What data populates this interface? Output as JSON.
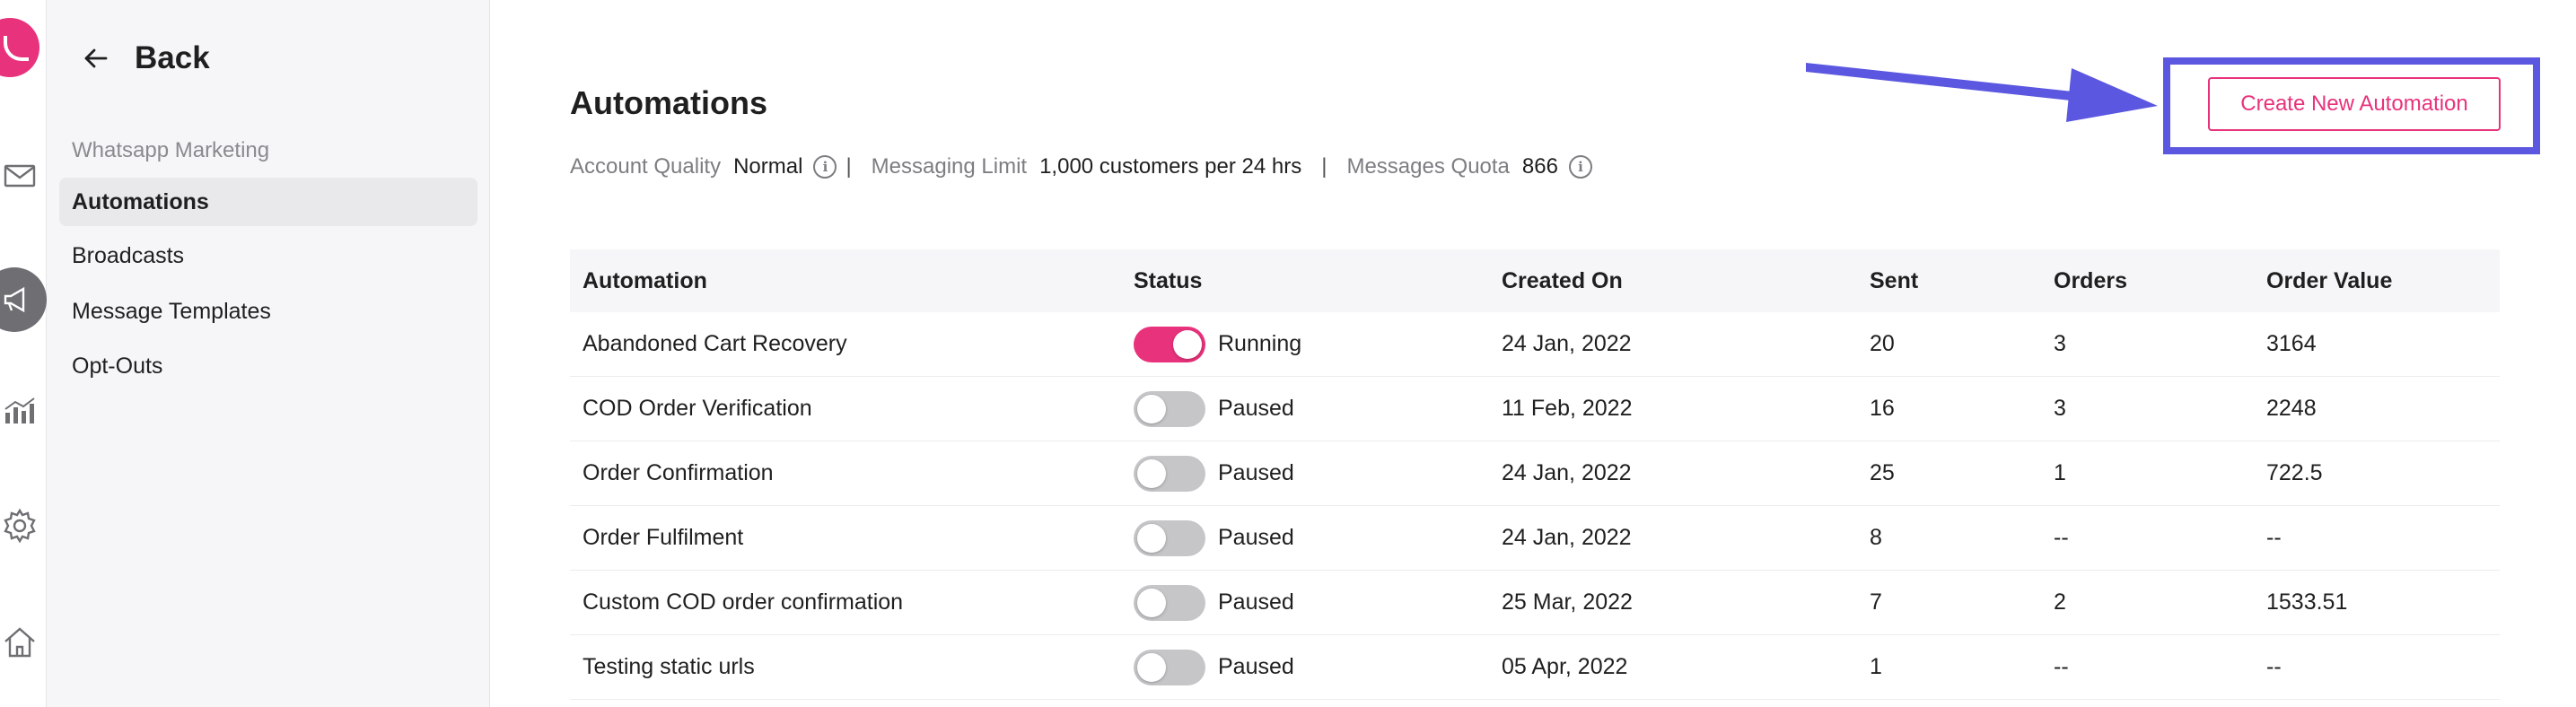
{
  "sidebar": {
    "back_label": "Back",
    "section_label": "Whatsapp Marketing",
    "items": [
      {
        "label": "Automations",
        "active": true
      },
      {
        "label": "Broadcasts",
        "active": false
      },
      {
        "label": "Message Templates",
        "active": false
      },
      {
        "label": "Opt-Outs",
        "active": false
      }
    ]
  },
  "rail": {
    "icons": [
      "logo",
      "mail-icon",
      "megaphone-icon",
      "analytics-icon",
      "gear-icon",
      "home-icon"
    ]
  },
  "main": {
    "title": "Automations",
    "meta": {
      "account_quality_label": "Account Quality",
      "account_quality_value": "Normal",
      "separator": "|",
      "messaging_limit_label": "Messaging Limit",
      "messaging_limit_value": "1,000 customers per 24 hrs",
      "messages_quota_label": "Messages Quota",
      "messages_quota_value": "866",
      "info_glyph": "i"
    },
    "create_button_label": "Create New Automation",
    "table": {
      "headers": [
        "Automation",
        "Status",
        "Created On",
        "Sent",
        "Orders",
        "Order Value"
      ],
      "rows": [
        {
          "name": "Abandoned Cart Recovery",
          "status": "Running",
          "on": true,
          "created": "24 Jan, 2022",
          "sent": "20",
          "orders": "3",
          "value": "3164"
        },
        {
          "name": "COD Order Verification",
          "status": "Paused",
          "on": false,
          "created": "11 Feb, 2022",
          "sent": "16",
          "orders": "3",
          "value": "2248"
        },
        {
          "name": "Order Confirmation",
          "status": "Paused",
          "on": false,
          "created": "24 Jan, 2022",
          "sent": "25",
          "orders": "1",
          "value": "722.5"
        },
        {
          "name": "Order Fulfilment",
          "status": "Paused",
          "on": false,
          "created": "24 Jan, 2022",
          "sent": "8",
          "orders": "--",
          "value": "--"
        },
        {
          "name": "Custom COD order confirmation",
          "status": "Paused",
          "on": false,
          "created": "25 Mar, 2022",
          "sent": "7",
          "orders": "2",
          "value": "1533.51"
        },
        {
          "name": "Testing static urls",
          "status": "Paused",
          "on": false,
          "created": "05 Apr, 2022",
          "sent": "1",
          "orders": "--",
          "value": "--"
        }
      ]
    }
  },
  "colors": {
    "brand": "#e8327c",
    "highlight": "#5b57e0",
    "sidebar_bg": "#f6f6f8",
    "toggle_off": "#c6c6c9"
  }
}
